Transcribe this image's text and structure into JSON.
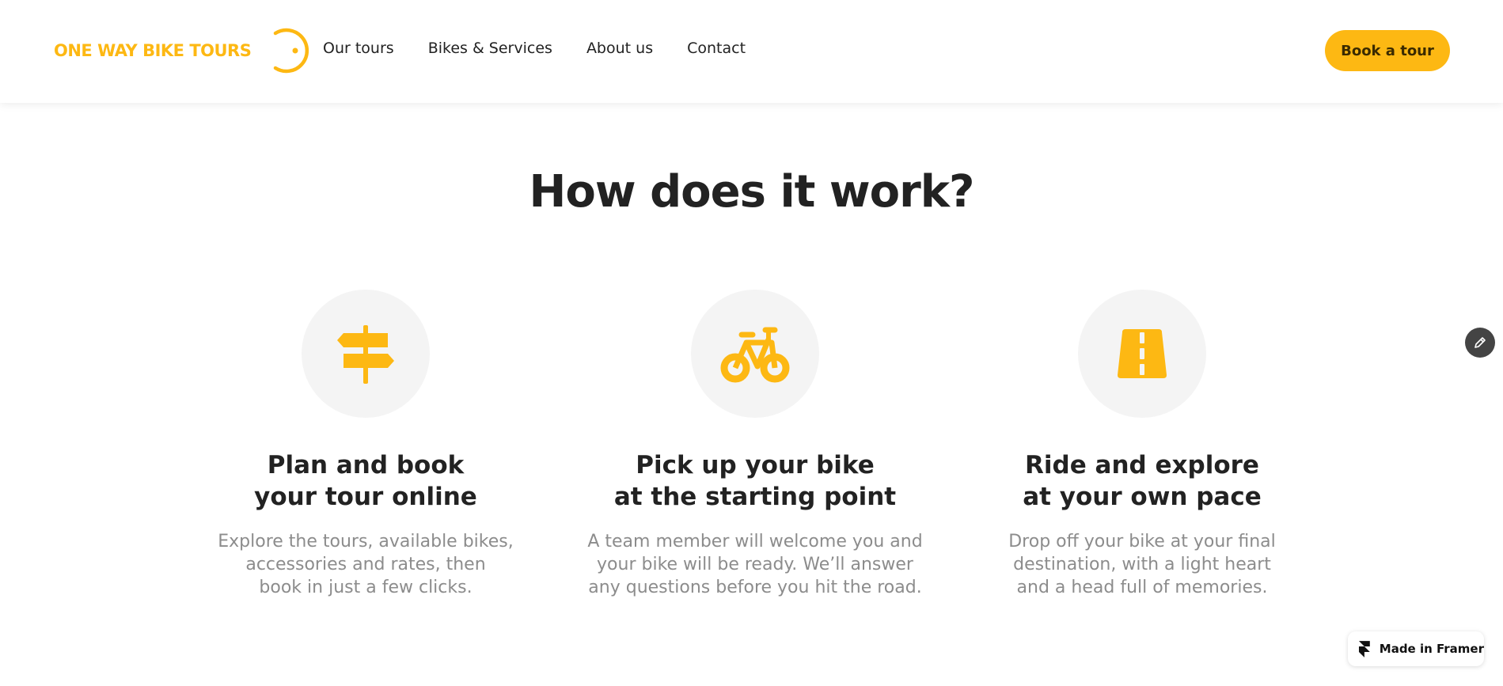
{
  "header": {
    "logo_text": "ONE WAY BIKE TOURS",
    "nav": [
      "Our tours",
      "Bikes & Services",
      "About us",
      "Contact"
    ],
    "cta_label": "Book a tour"
  },
  "main": {
    "heading": "How does it work?",
    "steps": [
      {
        "icon": "signpost-icon",
        "title_lines": [
          "Plan and book",
          "your tour online"
        ],
        "desc_lines": [
          "Explore the tours, available bikes,",
          "accessories and rates, then",
          "book in just a few clicks."
        ]
      },
      {
        "icon": "bicycle-icon",
        "title_lines": [
          "Pick up your bike",
          "at the starting point"
        ],
        "desc_lines": [
          "A team member will welcome you and",
          "your bike will be ready. We’ll answer",
          "any questions before you hit the road."
        ]
      },
      {
        "icon": "road-icon",
        "title_lines": [
          "Ride and explore",
          "at your own pace"
        ],
        "desc_lines": [
          "Drop off your bike at your final",
          "destination, with a light heart",
          "and a head full of memories."
        ]
      }
    ]
  },
  "framer_badge": {
    "label": "Made in Framer",
    "icon": "framer-logo-icon"
  },
  "edit_button": {
    "icon": "pencil-icon"
  },
  "colors": {
    "accent": "#FDB813",
    "text": "#222222",
    "muted": "#8c8c8c",
    "circle_bg": "#f4f4f4"
  }
}
